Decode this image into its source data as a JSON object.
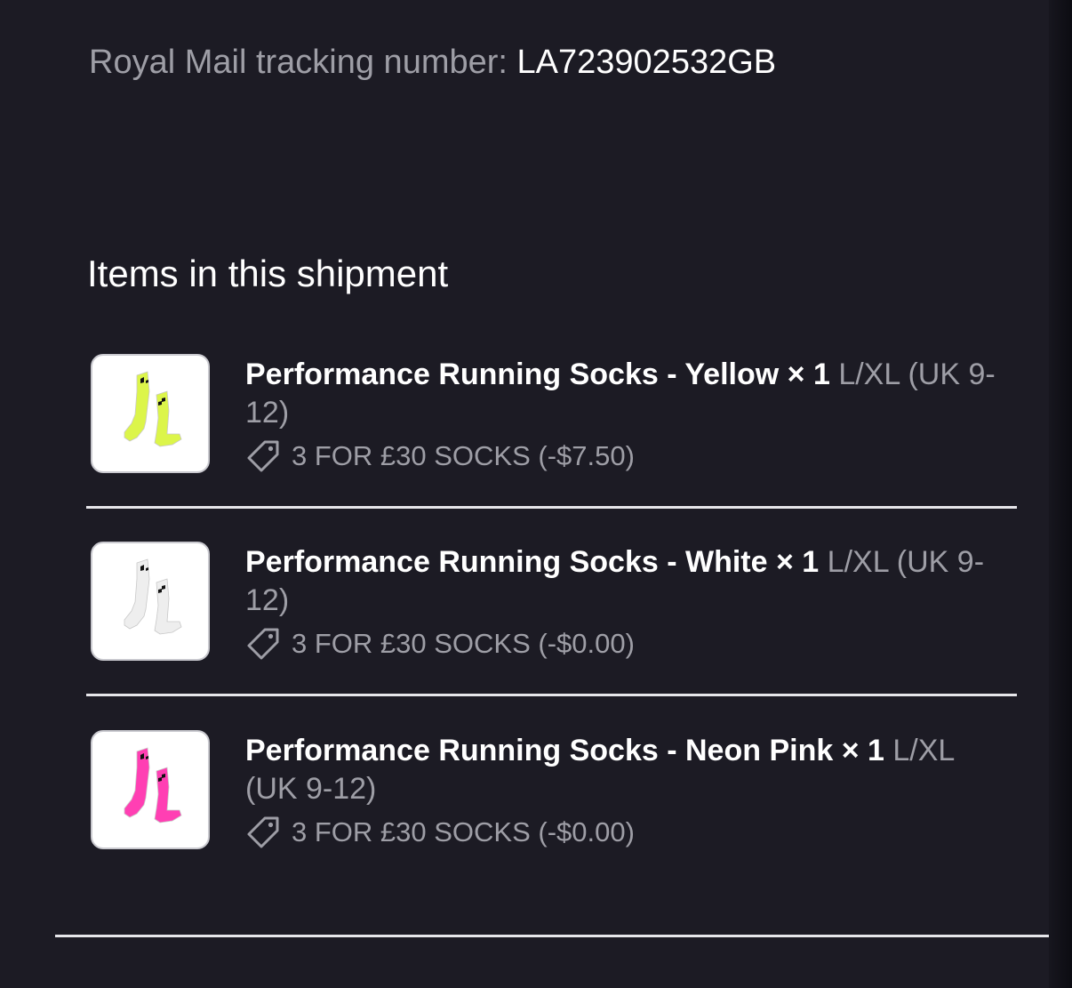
{
  "tracking": {
    "label": "Royal Mail tracking number:",
    "number": "LA723902532GB"
  },
  "shipment": {
    "title": "Items in this shipment",
    "items": [
      {
        "name": "Performance Running Socks - Yellow",
        "quantity": "× 1",
        "variant": "L/XL (UK 9-12)",
        "discount": "3 FOR £30 SOCKS (-$7.50)",
        "sock_color": "#dcf54a",
        "thumb_icon": "sock-pair-image"
      },
      {
        "name": "Performance Running Socks - White",
        "quantity": "× 1",
        "variant": "L/XL (UK 9-12)",
        "discount": "3 FOR £30 SOCKS (-$0.00)",
        "sock_color": "#eeeeee",
        "thumb_icon": "sock-pair-image"
      },
      {
        "name": "Performance Running Socks - Neon Pink",
        "quantity": "× 1",
        "variant": "L/XL (UK 9-12)",
        "discount": "3 FOR £30 SOCKS (-$0.00)",
        "sock_color": "#ff3fb3",
        "thumb_icon": "sock-pair-image"
      }
    ]
  },
  "theme": {
    "background": "#1c1b24",
    "muted_text": "#9e9ea6",
    "text": "#ffffff",
    "divider": "#e6e6ea"
  }
}
